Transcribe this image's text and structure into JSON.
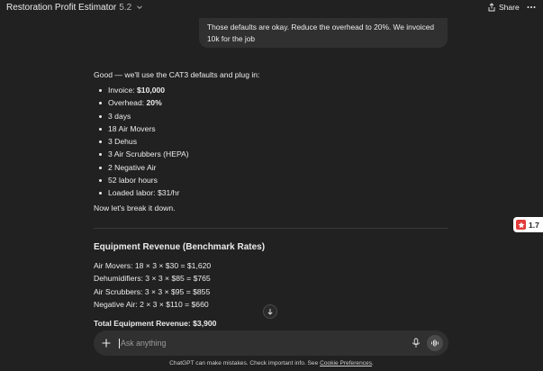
{
  "header": {
    "title": "Restoration Profit Estimator",
    "version": "5.2",
    "share_label": "Share"
  },
  "user_message": "Those defaults are okay. Reduce the overhead to 20%. We invoiced 10k for the job",
  "assistant": {
    "intro": "Good — we'll use the CAT3 defaults and plug in:",
    "bullets": [
      {
        "label": "Invoice: ",
        "value": "$10,000"
      },
      {
        "label": "Overhead: ",
        "value": "20%"
      },
      {
        "label": "3 days",
        "value": ""
      },
      {
        "label": "18 Air Movers",
        "value": ""
      },
      {
        "label": "3 Dehus",
        "value": ""
      },
      {
        "label": "3 Air Scrubbers (HEPA)",
        "value": ""
      },
      {
        "label": "2 Negative Air",
        "value": ""
      },
      {
        "label": "52 labor hours",
        "value": ""
      },
      {
        "label": "Loaded labor: $31/hr",
        "value": ""
      }
    ],
    "outro": "Now let's break it down.",
    "section_title": "Equipment Revenue (Benchmark Rates)",
    "equations": [
      "Air Movers: 18 × 3 × $30 = $1,620",
      "Dehumidifiers: 3 × 3 × $85 = $765",
      "Air Scrubbers: 3 × 3 × $95 = $855",
      "Negative Air: 2 × 3 × $110 = $660"
    ],
    "total": "Total Equipment Revenue: $3,900"
  },
  "rating_badge": {
    "value": "1.7",
    "color": "#e23b3b"
  },
  "composer": {
    "placeholder": "Ask anything"
  },
  "disclaimer": {
    "text": "ChatGPT can make mistakes. Check important info. See ",
    "link": "Cookie Preferences",
    "end": "."
  },
  "colors": {
    "background": "#212121",
    "bubble": "#303030",
    "text": "#ececec"
  }
}
